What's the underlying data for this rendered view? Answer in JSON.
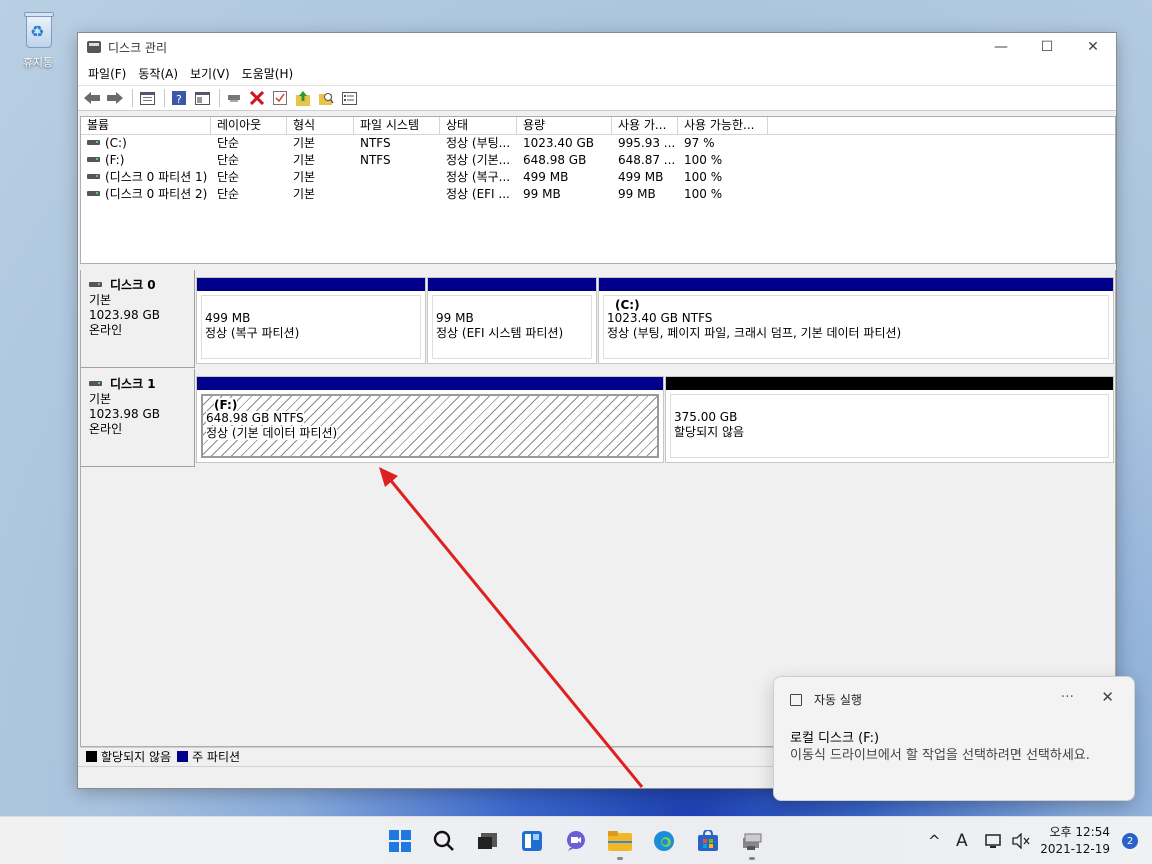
{
  "desktop": {
    "recycle_bin_label": "휴지통"
  },
  "window": {
    "title": "디스크 관리",
    "controls": {
      "minimize": "—",
      "maximize": "☐",
      "close": "✕"
    },
    "menu": [
      "파일(F)",
      "동작(A)",
      "보기(V)",
      "도움말(H)"
    ],
    "toolbar_icons": [
      "back-icon",
      "forward-icon",
      "console-tree-icon",
      "help-icon",
      "properties-view-icon",
      "connect-icon",
      "delete-icon",
      "check-icon",
      "up-icon",
      "search-icon",
      "list-icon"
    ]
  },
  "volume_list": {
    "columns": [
      "볼륨",
      "레이아웃",
      "형식",
      "파일 시스템",
      "상태",
      "용량",
      "사용 가...",
      "사용 가능한..."
    ],
    "rows": [
      [
        "(C:)",
        "단순",
        "기본",
        "NTFS",
        "정상 (부팅...",
        "1023.40 GB",
        "995.93 ...",
        "97 %"
      ],
      [
        "(F:)",
        "단순",
        "기본",
        "NTFS",
        "정상 (기본...",
        "648.98 GB",
        "648.87 ...",
        "100 %"
      ],
      [
        "(디스크 0 파티션 1)",
        "단순",
        "기본",
        "",
        "정상 (복구...",
        "499 MB",
        "499 MB",
        "100 %"
      ],
      [
        "(디스크 0 파티션 2)",
        "단순",
        "기본",
        "",
        "정상 (EFI ...",
        "99 MB",
        "99 MB",
        "100 %"
      ]
    ]
  },
  "disks": [
    {
      "name": "디스크 0",
      "type": "기본",
      "size": "1023.98 GB",
      "status": "온라인",
      "partitions": [
        {
          "label": "",
          "size": "499 MB",
          "status": "정상 (복구 파티션)",
          "kind": "primary"
        },
        {
          "label": "",
          "size": "99 MB",
          "status": "정상 (EFI 시스템 파티션)",
          "kind": "primary"
        },
        {
          "label": "(C:)",
          "size": "1023.40 GB NTFS",
          "status": "정상 (부팅, 페이지 파일, 크래시 덤프, 기본 데이터 파티션)",
          "kind": "primary"
        }
      ]
    },
    {
      "name": "디스크 1",
      "type": "기본",
      "size": "1023.98 GB",
      "status": "온라인",
      "partitions": [
        {
          "label": "(F:)",
          "size": "648.98 GB NTFS",
          "status": "정상 (기본 데이터 파티션)",
          "kind": "primary"
        },
        {
          "label": "",
          "size": "375.00 GB",
          "status": "할당되지 않음",
          "kind": "unallocated"
        }
      ]
    }
  ],
  "legend": [
    {
      "label": "할당되지 않음",
      "color": "#000000"
    },
    {
      "label": "주 파티션",
      "color": "#00008b"
    }
  ],
  "toast": {
    "app": "자동 실행",
    "more": "···",
    "close": "✕",
    "title": "로컬 디스크 (F:)",
    "body": "이동식 드라이브에서 할 작업을 선택하려면 선택하세요."
  },
  "taskbar": {
    "apps": [
      "start-icon",
      "search-icon",
      "task-view-icon",
      "widgets-icon",
      "chat-icon",
      "file-explorer-icon",
      "edge-icon",
      "store-icon",
      "disk-management-icon"
    ],
    "tray": {
      "chevron": "^",
      "ime": "A"
    },
    "time": "오후 12:54",
    "date": "2021-12-19",
    "notification_count": "2"
  },
  "colors": {
    "primary_partition": "#00008b",
    "unallocated": "#000000",
    "annotation_arrow": "#e02020"
  }
}
